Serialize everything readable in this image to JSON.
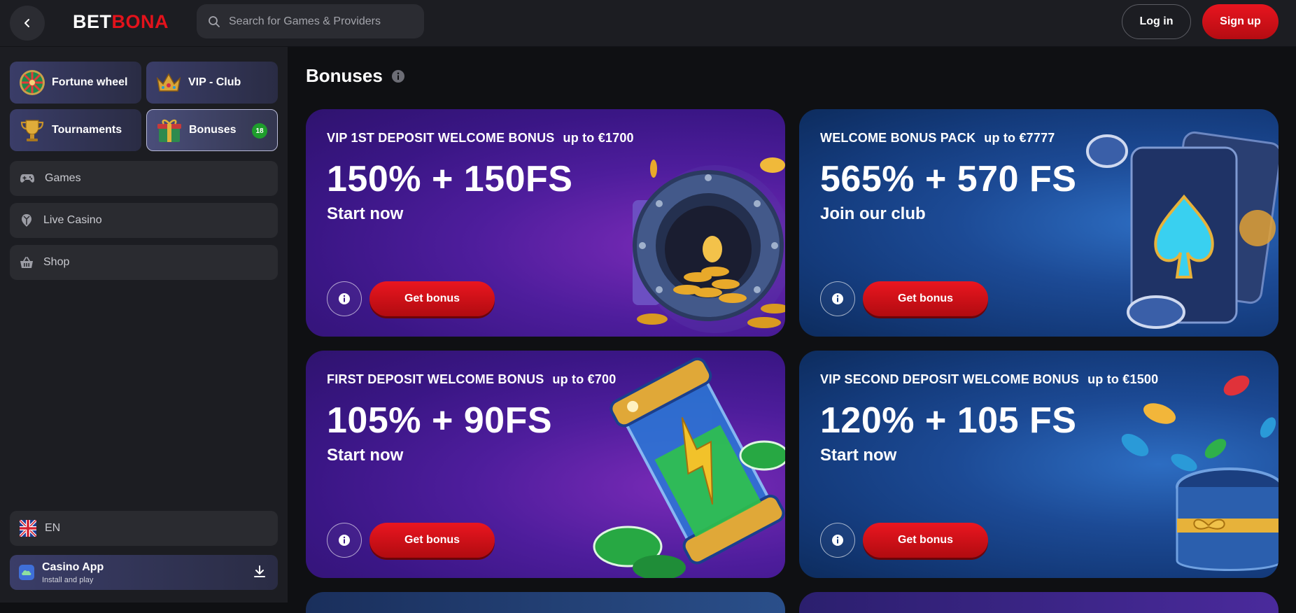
{
  "header": {
    "logo_part1": "BET",
    "logo_part2": "BONA",
    "search_placeholder": "Search for Games & Providers",
    "login_label": "Log in",
    "signup_label": "Sign up"
  },
  "sidebar": {
    "tiles": [
      {
        "label": "Fortune wheel",
        "icon": "fortune-wheel-icon"
      },
      {
        "label": "VIP - Club",
        "icon": "crown-icon"
      },
      {
        "label": "Tournaments",
        "icon": "trophy-icon"
      },
      {
        "label": "Bonuses",
        "icon": "gift-icon",
        "badge": "18"
      }
    ],
    "nav": [
      {
        "label": "Games",
        "icon": "gamepad-icon"
      },
      {
        "label": "Live Casino",
        "icon": "live-casino-icon"
      },
      {
        "label": "Shop",
        "icon": "basket-icon"
      }
    ],
    "language": {
      "label": "EN",
      "icon": "uk-flag-icon"
    },
    "app": {
      "title": "Casino App",
      "subtitle": "Install and play",
      "icon": "cloud-icon"
    }
  },
  "main": {
    "title": "Bonuses",
    "cards": [
      {
        "caption": "VIP 1ST DEPOSIT WELCOME BONUS",
        "upto": "up to €1700",
        "headline": "150% + 150FS",
        "cta_text": "Start now",
        "button": "Get bonus",
        "theme": "purple",
        "art": "vault-icon"
      },
      {
        "caption": "WELCOME BONUS PACK",
        "upto": "up to €7777",
        "headline": "565% + 570 FS",
        "cta_text": "Join our club",
        "button": "Get bonus",
        "theme": "blue",
        "art": "playing-cards-icon"
      },
      {
        "caption": "FIRST DEPOSIT WELCOME BONUS",
        "upto": "up to €700",
        "headline": "105% + 90FS",
        "cta_text": "Start now",
        "button": "Get bonus",
        "theme": "purple",
        "art": "energy-capsule-icon"
      },
      {
        "caption": "VIP SECOND DEPOSIT WELCOME BONUS",
        "upto": "up to €1500",
        "headline": "120% + 105 FS",
        "cta_text": "Start now",
        "button": "Get bonus",
        "theme": "blue",
        "art": "gift-box-icon"
      }
    ]
  },
  "colors": {
    "accent_red": "#e3121b",
    "badge_green": "#1e9d2c",
    "header_bg": "#1c1d22",
    "page_bg": "#0f1013"
  }
}
